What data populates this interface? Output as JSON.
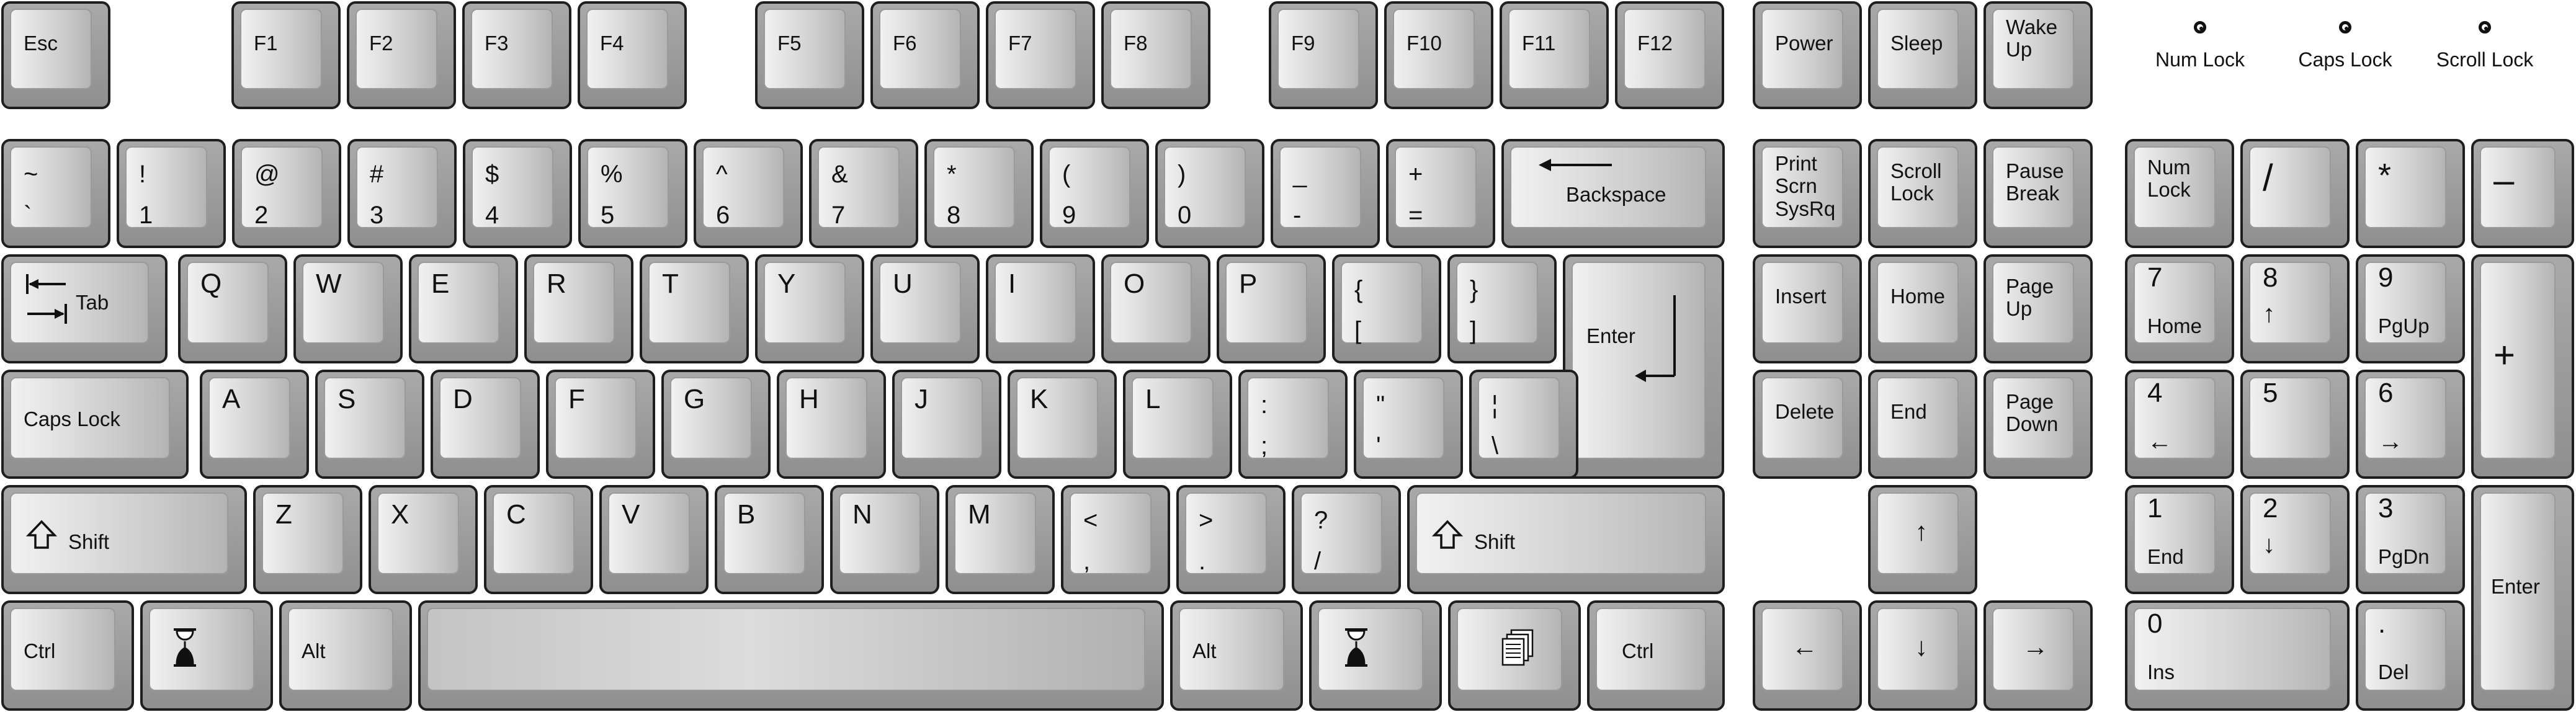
{
  "keyboard": {
    "function_row": {
      "esc": "Esc",
      "f1": "F1",
      "f2": "F2",
      "f3": "F3",
      "f4": "F4",
      "f5": "F5",
      "f6": "F6",
      "f7": "F7",
      "f8": "F8",
      "f9": "F9",
      "f10": "F10",
      "f11": "F11",
      "f12": "F12",
      "power": "Power",
      "sleep": "Sleep",
      "wake_up": "Wake\nUp"
    },
    "indicators": {
      "num_lock": "Num Lock",
      "caps_lock": "Caps Lock",
      "scroll_lock": "Scroll Lock"
    },
    "number_row": [
      {
        "top": "~",
        "bottom": "`"
      },
      {
        "top": "!",
        "bottom": "1"
      },
      {
        "top": "@",
        "bottom": "2"
      },
      {
        "top": "#",
        "bottom": "3"
      },
      {
        "top": "$",
        "bottom": "4"
      },
      {
        "top": "%",
        "bottom": "5"
      },
      {
        "top": "^",
        "bottom": "6"
      },
      {
        "top": "&",
        "bottom": "7"
      },
      {
        "top": "*",
        "bottom": "8"
      },
      {
        "top": "(",
        "bottom": "9"
      },
      {
        "top": ")",
        "bottom": "0"
      },
      {
        "top": "_",
        "bottom": "-"
      },
      {
        "top": "+",
        "bottom": "="
      }
    ],
    "backspace": "Backspace",
    "tab": "Tab",
    "qwerty_row": [
      "Q",
      "W",
      "E",
      "R",
      "T",
      "Y",
      "U",
      "I",
      "O",
      "P"
    ],
    "brace_open": {
      "top": "{",
      "bottom": "["
    },
    "brace_close": {
      "top": "}",
      "bottom": "]"
    },
    "enter": "Enter",
    "caps_lock": "Caps Lock",
    "home_row": [
      "A",
      "S",
      "D",
      "F",
      "G",
      "H",
      "J",
      "K",
      "L"
    ],
    "colon": {
      "top": ":",
      "bottom": ";"
    },
    "quote": {
      "top": "\"",
      "bottom": "'"
    },
    "pipe": {
      "top": "¦",
      "bottom": "\\"
    },
    "shift": "Shift",
    "bottom_letters": [
      "Z",
      "X",
      "C",
      "V",
      "B",
      "N",
      "M"
    ],
    "lt": {
      "top": "<",
      "bottom": ","
    },
    "gt": {
      "top": ">",
      "bottom": "."
    },
    "question": {
      "top": "?",
      "bottom": "/"
    },
    "ctrl": "Ctrl",
    "alt": "Alt",
    "nav": {
      "print_screen": "Print\nScrn\nSysRq",
      "scroll_lock": "Scroll\nLock",
      "pause": "Pause\nBreak",
      "insert": "Insert",
      "home": "Home",
      "page_up": "Page\nUp",
      "delete": "Delete",
      "end": "End",
      "page_down": "Page\nDown",
      "up": "↑",
      "left": "←",
      "down": "↓",
      "right": "→"
    },
    "numpad": {
      "num_lock": "Num\nLock",
      "divide": "/",
      "multiply": "*",
      "minus": "–",
      "plus": "+",
      "n7": "7",
      "n7_sub": "Home",
      "n8": "8",
      "n8_sub": "↑",
      "n9": "9",
      "n9_sub": "PgUp",
      "n4": "4",
      "n4_sub": "←",
      "n5": "5",
      "n6": "6",
      "n6_sub": "→",
      "n1": "1",
      "n1_sub": "End",
      "n2": "2",
      "n2_sub": "↓",
      "n3": "3",
      "n3_sub": "PgDn",
      "n0": "0",
      "n0_sub": "Ins",
      "dot": ".",
      "dot_sub": "Del",
      "enter": "Enter"
    }
  }
}
